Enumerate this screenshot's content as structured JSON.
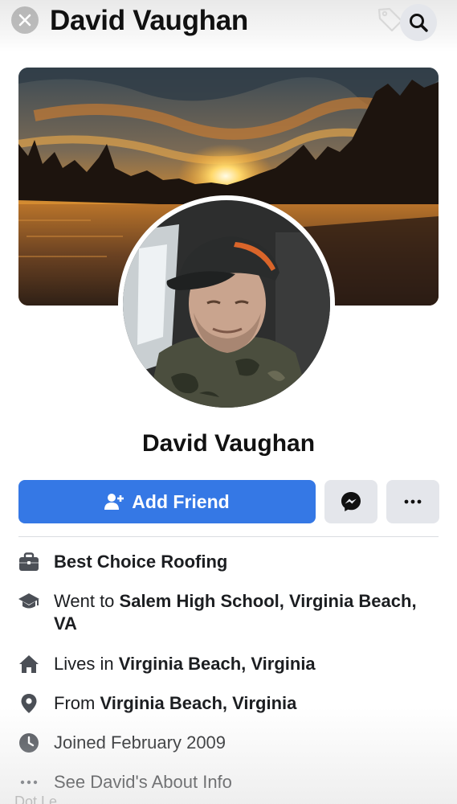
{
  "header": {
    "title": "David Vaughan",
    "close_icon": "close-icon",
    "tag_icon": "tag-icon",
    "search_icon": "search-icon"
  },
  "profile": {
    "name": "David Vaughan",
    "cover_description": "sunset-over-lake",
    "avatar_description": "profile-photo"
  },
  "actions": {
    "add_friend_label": "Add Friend",
    "add_friend_icon": "add-person-icon",
    "messenger_icon": "messenger-icon",
    "more_icon": "more-dots-icon"
  },
  "info": [
    {
      "icon": "briefcase-icon",
      "prefix": "",
      "bold": "Best Choice Roofing"
    },
    {
      "icon": "graduation-cap-icon",
      "prefix": "Went to ",
      "bold": "Salem High School, Virginia Beach, VA"
    },
    {
      "icon": "home-icon",
      "prefix": "Lives in ",
      "bold": "Virginia Beach, Virginia"
    },
    {
      "icon": "location-pin-icon",
      "prefix": "From ",
      "bold": "Virginia Beach, Virginia"
    },
    {
      "icon": "clock-icon",
      "prefix": "Joined February 2009",
      "bold": ""
    },
    {
      "icon": "more-dots-icon",
      "prefix": "See David's About Info",
      "bold": ""
    }
  ],
  "footer": {
    "caption": "Dot Le"
  },
  "colors": {
    "accent": "#3578e5",
    "button_gray": "#e4e6eb",
    "text": "#1c1e21"
  }
}
